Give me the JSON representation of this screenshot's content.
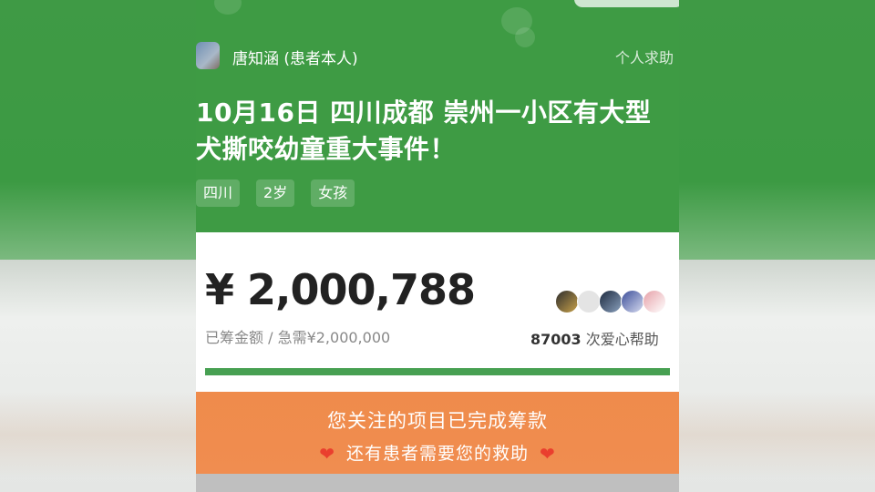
{
  "post": {
    "author": "唐知涵 (患者本人)",
    "type_label": "个人求助",
    "title_line1": "10月16日 四川成都 崇州一小区有大型",
    "title_line2": "犬撕咬幼童重大事件！",
    "tags": [
      "四川",
      "2岁",
      "女孩"
    ]
  },
  "fundraising": {
    "amount": "¥ 2,000,788",
    "raised_label": "已筹金额 / 急需¥2,000,000",
    "help_count": "87003",
    "help_suffix": " 次爱心帮助",
    "progress_fraction": 1.0
  },
  "banner": {
    "line1": "您关注的项目已完成筹款",
    "line2": "还有患者需要您的救助"
  },
  "colors": {
    "header_green": "#3e9b44",
    "progress_green": "#47a052",
    "banner_orange": "#ef8b4b",
    "heart_red": "#ea3f2e"
  },
  "icons": {
    "heart": "heart-icon"
  }
}
